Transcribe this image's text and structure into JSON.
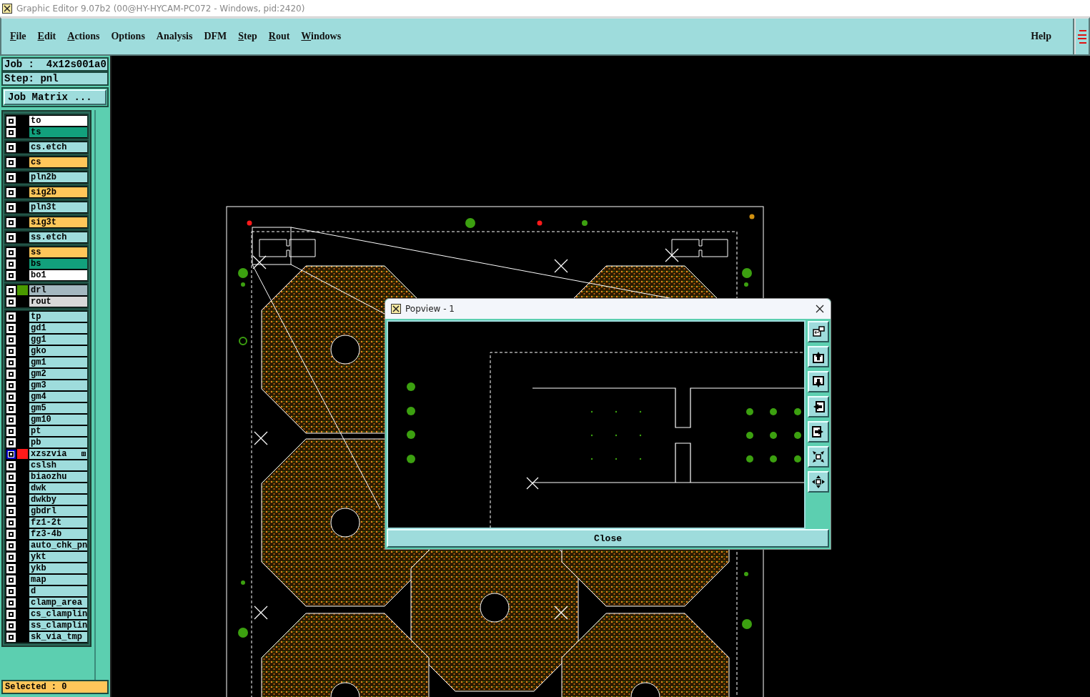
{
  "window": {
    "title": "Graphic Editor 9.07b2 (00@HY-HYCAM-PC072 - Windows, pid:2420)"
  },
  "menu": [
    {
      "label": "File",
      "underlined": true
    },
    {
      "label": "Edit",
      "underlined": true
    },
    {
      "label": "Actions",
      "underlined": true
    },
    {
      "label": "Options",
      "underlined": false
    },
    {
      "label": "Analysis",
      "underlined": false
    },
    {
      "label": "DFM",
      "underlined": false
    },
    {
      "label": "Step",
      "underlined": true
    },
    {
      "label": "Rout",
      "underlined": true
    },
    {
      "label": "Windows",
      "underlined": true
    }
  ],
  "help_menu": {
    "label": "Help"
  },
  "job": "Job :  4x12s001a0",
  "step": "Step: pnl",
  "job_matrix_button": "Job Matrix ...",
  "layer_groups": [
    {
      "layers": [
        {
          "name": "to",
          "color": "#ffffff",
          "selected": false,
          "attributes": false
        },
        {
          "name": "ts",
          "color": "#12a07c",
          "selected": false,
          "attributes": false
        }
      ]
    },
    {
      "layers": [
        {
          "name": "cs.etch",
          "color": "#9edcdc",
          "selected": false,
          "attributes": false
        }
      ]
    },
    {
      "layers": [
        {
          "name": "cs",
          "color": "#ffc65a",
          "selected": false,
          "attributes": false
        }
      ]
    },
    {
      "layers": [
        {
          "name": "pln2b",
          "color": "#9edcdc",
          "selected": false,
          "attributes": false
        }
      ]
    },
    {
      "layers": [
        {
          "name": "sig2b",
          "color": "#ffc65a",
          "selected": false,
          "attributes": false
        }
      ]
    },
    {
      "layers": [
        {
          "name": "pln3t",
          "color": "#9edcdc",
          "selected": false,
          "attributes": false
        }
      ]
    },
    {
      "layers": [
        {
          "name": "sig3t",
          "color": "#ffc65a",
          "selected": false,
          "attributes": false
        }
      ]
    },
    {
      "layers": [
        {
          "name": "ss.etch",
          "color": "#9edcdc",
          "selected": false,
          "attributes": false
        }
      ]
    },
    {
      "layers": [
        {
          "name": "ss",
          "color": "#ffc65a",
          "selected": false,
          "attributes": false
        },
        {
          "name": "bs",
          "color": "#12a07c",
          "selected": false,
          "attributes": false
        },
        {
          "name": "bo1",
          "color": "#ffffff",
          "selected": false,
          "attributes": false
        }
      ]
    },
    {
      "layers": [
        {
          "name": "drl",
          "color": "#a4b8c0",
          "swatch": {
            "color": "#4a9a00"
          },
          "selected": false,
          "attributes": false
        },
        {
          "name": "rout",
          "color": "#d8d8d8",
          "selected": false,
          "attributes": false
        }
      ]
    },
    {
      "layers": [
        {
          "name": "tp",
          "color": "#9edcdc",
          "selected": false,
          "attributes": false
        },
        {
          "name": "gd1",
          "color": "#9edcdc",
          "selected": false,
          "attributes": false
        },
        {
          "name": "gg1",
          "color": "#9edcdc",
          "selected": false,
          "attributes": false
        },
        {
          "name": "gko",
          "color": "#9edcdc",
          "selected": false,
          "attributes": false
        },
        {
          "name": "gm1",
          "color": "#9edcdc",
          "selected": false,
          "attributes": false
        },
        {
          "name": "gm2",
          "color": "#9edcdc",
          "selected": false,
          "attributes": false
        },
        {
          "name": "gm3",
          "color": "#9edcdc",
          "selected": false,
          "attributes": false
        },
        {
          "name": "gm4",
          "color": "#9edcdc",
          "selected": false,
          "attributes": false
        },
        {
          "name": "gm5",
          "color": "#9edcdc",
          "selected": false,
          "attributes": false
        },
        {
          "name": "gm10",
          "color": "#9edcdc",
          "selected": false,
          "attributes": false
        },
        {
          "name": "pt",
          "color": "#9edcdc",
          "selected": false,
          "attributes": false
        },
        {
          "name": "pb",
          "color": "#9edcdc",
          "selected": false,
          "attributes": false
        },
        {
          "name": "xzszvia",
          "color": "#9edcdc",
          "swatch": {
            "color": "#ff1a1a"
          },
          "selected": true,
          "attributes": true
        },
        {
          "name": "cslsh",
          "color": "#9edcdc",
          "selected": false,
          "attributes": false
        },
        {
          "name": "biaozhu",
          "color": "#9edcdc",
          "selected": false,
          "attributes": false
        },
        {
          "name": "dwk",
          "color": "#9edcdc",
          "selected": false,
          "attributes": false
        },
        {
          "name": "dwkby",
          "color": "#9edcdc",
          "selected": false,
          "attributes": false
        },
        {
          "name": "gbdrl",
          "color": "#9edcdc",
          "selected": false,
          "attributes": false
        },
        {
          "name": "fz1-2t",
          "color": "#9edcdc",
          "selected": false,
          "attributes": false
        },
        {
          "name": "fz3-4b",
          "color": "#9edcdc",
          "selected": false,
          "attributes": false
        },
        {
          "name": "auto_chk_pn",
          "color": "#9edcdc",
          "selected": false,
          "attributes": false
        },
        {
          "name": "ykt",
          "color": "#9edcdc",
          "selected": false,
          "attributes": false
        },
        {
          "name": "ykb",
          "color": "#9edcdc",
          "selected": false,
          "attributes": false
        },
        {
          "name": "map",
          "color": "#9edcdc",
          "selected": false,
          "attributes": false
        },
        {
          "name": "d",
          "color": "#9edcdc",
          "selected": false,
          "attributes": false
        },
        {
          "name": "clamp_area",
          "color": "#9edcdc",
          "selected": false,
          "attributes": false
        },
        {
          "name": "cs_clamplin",
          "color": "#9edcdc",
          "selected": false,
          "attributes": false
        },
        {
          "name": "ss_clamplin",
          "color": "#9edcdc",
          "selected": false,
          "attributes": false
        },
        {
          "name": "sk_via_tmp",
          "color": "#9edcdc",
          "selected": false,
          "attributes": false
        }
      ]
    }
  ],
  "status": "Selected : 0",
  "popview": {
    "title": "Popview - 1",
    "close_button": "Close"
  }
}
